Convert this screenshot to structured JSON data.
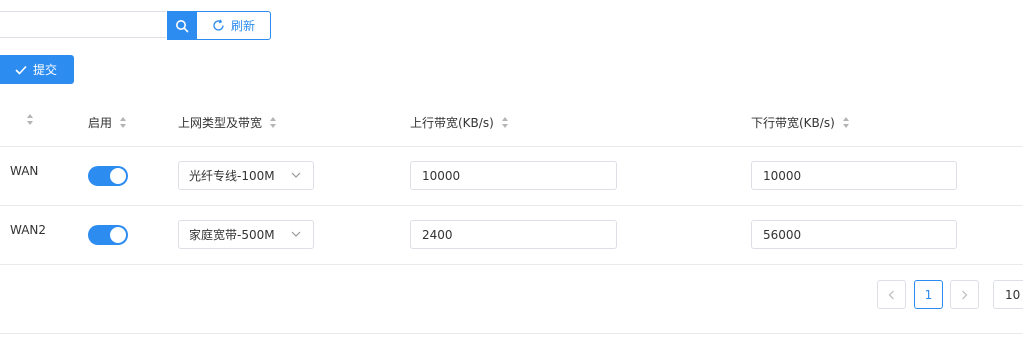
{
  "toolbar": {
    "search_placeholder": "",
    "refresh_label": "刷新",
    "submit_label": "提交"
  },
  "table": {
    "headers": {
      "col0": "",
      "enable": "启用",
      "line_type": "上网类型及带宽",
      "upload": "上行带宽(KB/s)",
      "download": "下行带宽(KB/s)"
    },
    "rows": [
      {
        "name": "WAN",
        "enabled": true,
        "line_type": "光纤专线-100M",
        "upload": "10000",
        "download": "10000"
      },
      {
        "name": "WAN2",
        "enabled": true,
        "line_type": "家庭宽带-500M",
        "upload": "2400",
        "download": "56000"
      }
    ]
  },
  "pagination": {
    "current_page": "1",
    "page_size": "10"
  },
  "colors": {
    "accent": "#2d8cf0",
    "border": "#dcdfe6",
    "divider": "#e8eaec"
  }
}
